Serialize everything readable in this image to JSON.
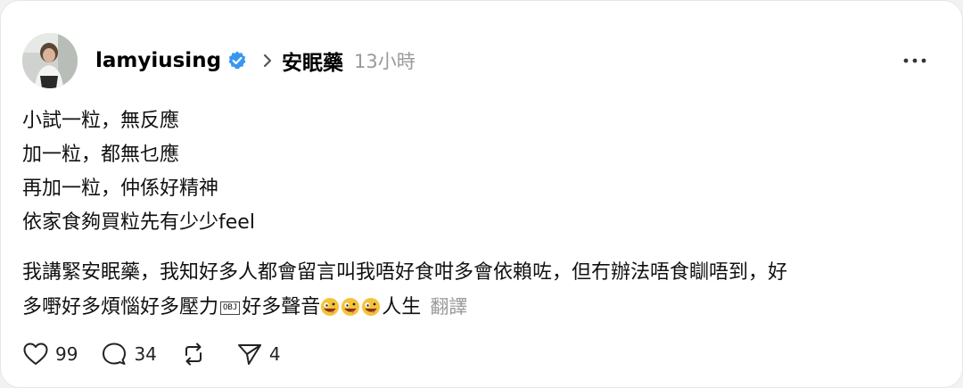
{
  "post": {
    "username": "lamyiusing",
    "topic": "安眠藥",
    "time": "13小時",
    "lines": [
      "小試一粒，無反應",
      "加一粒，都無乜應",
      "再加一粒，仲係好精神",
      "依家食夠買粒先有少少feel"
    ],
    "para2_line1": "我講緊安眠藥，我知好多人都會留言叫我唔好食咁多會依賴咗，但冇辦法唔食瞓唔到，好",
    "para2_line2_a": "多嘢好多煩惱好多壓力",
    "obj_placeholder": "OBJ",
    "para2_line2_b": "好多聲音",
    "para2_line2_c": "人生",
    "translate": "翻譯",
    "emoji_icon": "zany-face-emoji"
  },
  "actions": {
    "likes": "99",
    "comments": "34",
    "reposts": "",
    "shares": "4"
  },
  "colors": {
    "verified": "#3897f0",
    "meta_gray": "#9a9a9a",
    "card_bg": "#ffffff"
  }
}
